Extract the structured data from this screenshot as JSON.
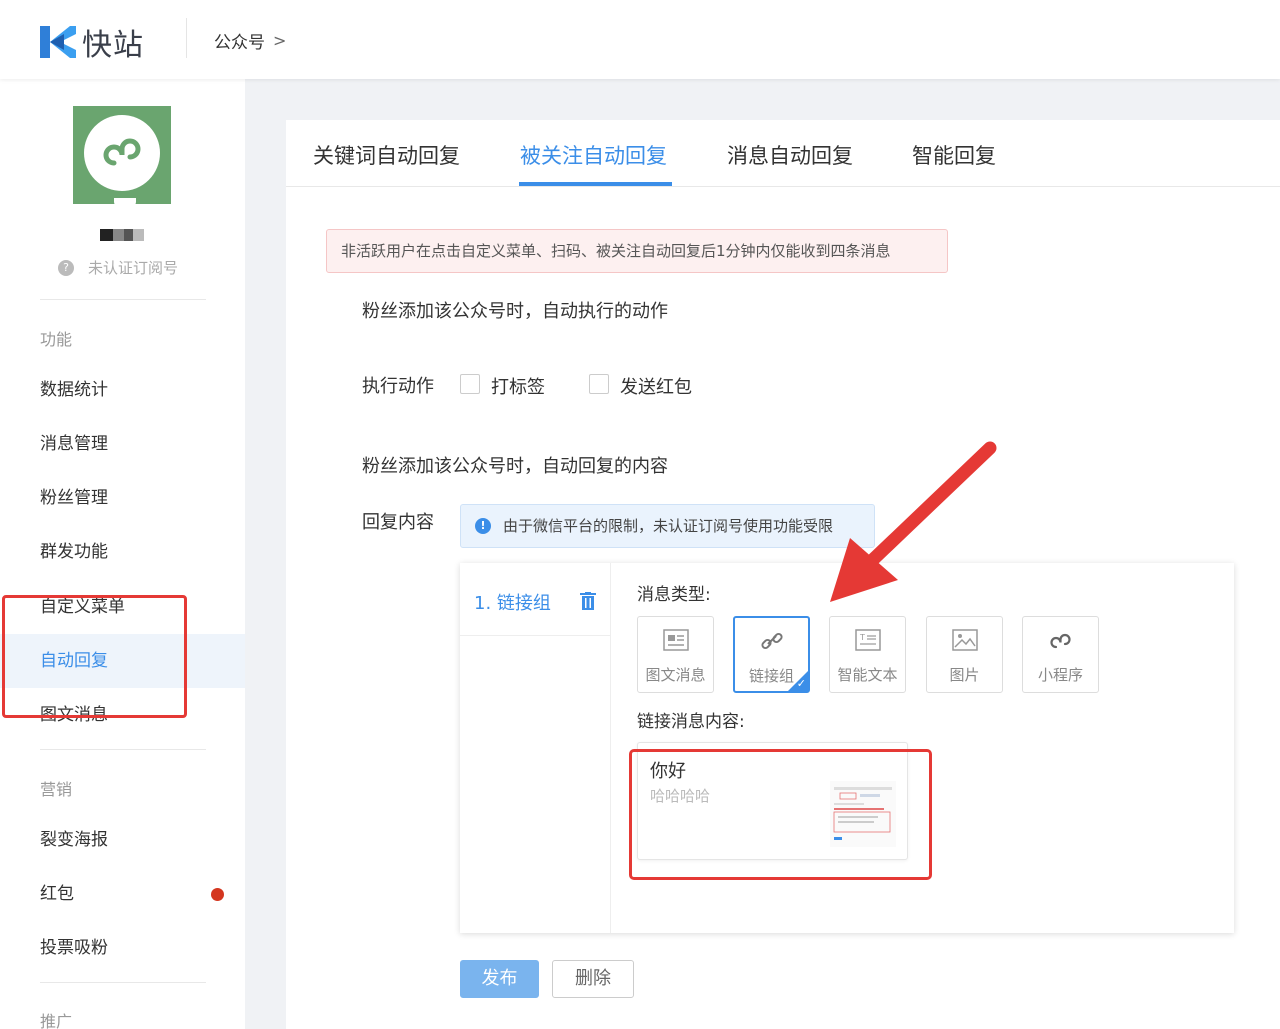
{
  "header": {
    "logo_text": "快站",
    "breadcrumb": "公众号",
    "breadcrumb_chevron": ">"
  },
  "sidebar": {
    "account_status": "未认证订阅号",
    "sections": [
      {
        "label": "功能",
        "items": [
          "数据统计",
          "消息管理",
          "粉丝管理",
          "群发功能",
          "自定义菜单",
          "自动回复",
          "图文消息"
        ]
      },
      {
        "label": "营销",
        "items": [
          "裂变海报",
          "红包",
          "投票吸粉"
        ]
      },
      {
        "label": "推广"
      }
    ],
    "active_item": "自动回复"
  },
  "tabs": [
    "关键词自动回复",
    "被关注自动回复",
    "消息自动回复",
    "智能回复"
  ],
  "active_tab": "被关注自动回复",
  "content": {
    "warning": "非活跃用户在点击自定义菜单、扫码、被关注自动回复后1分钟内仅能收到四条消息",
    "action_heading": "粉丝添加该公众号时，自动执行的动作",
    "action_label": "执行动作",
    "action_options": [
      "打标签",
      "发送红包"
    ],
    "reply_heading": "粉丝添加该公众号时，自动回复的内容",
    "reply_label": "回复内容",
    "info": "由于微信平台的限制，未认证订阅号使用功能受限",
    "group_item": "1.  链接组",
    "msg_type_label": "消息类型:",
    "msg_types": [
      "图文消息",
      "链接组",
      "智能文本",
      "图片",
      "小程序"
    ],
    "selected_type": "链接组",
    "link_content_label": "链接消息内容:",
    "link_card": {
      "title": "你好",
      "desc": "哈哈哈哈"
    },
    "publish_label": "发布",
    "delete_label": "删除"
  },
  "colors": {
    "accent": "#3b8ee8",
    "highlight": "#e53935",
    "red_dot": "#d4361f"
  }
}
